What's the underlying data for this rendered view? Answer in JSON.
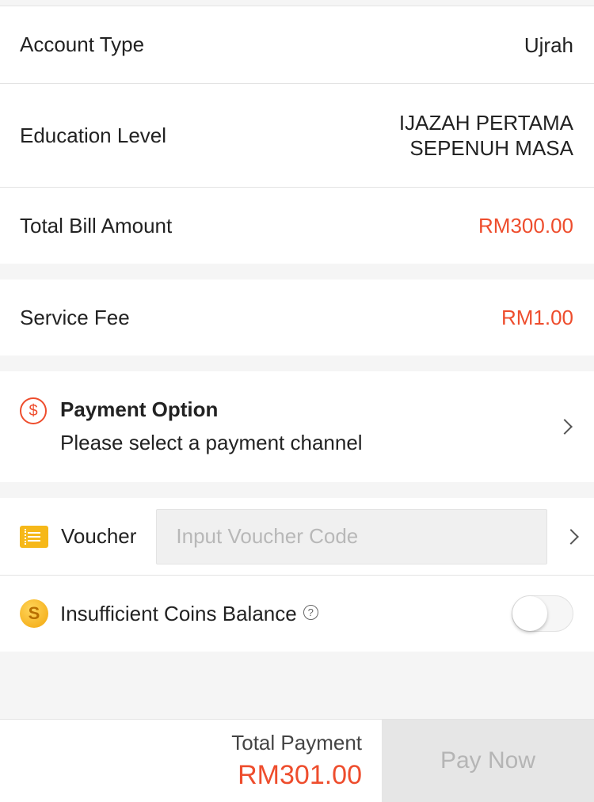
{
  "details": {
    "account_type_label": "Account Type",
    "account_type_value": "Ujrah",
    "education_level_label": "Education Level",
    "education_level_value_line1": "IJAZAH PERTAMA",
    "education_level_value_line2": "SEPENUH MASA",
    "total_bill_label": "Total Bill Amount",
    "total_bill_value": "RM300.00"
  },
  "service_fee": {
    "label": "Service Fee",
    "value": "RM1.00"
  },
  "payment_option": {
    "icon": "dollar-circle-icon",
    "title": "Payment Option",
    "subtitle": "Please select a payment channel"
  },
  "voucher": {
    "icon": "voucher-ticket-icon",
    "label": "Voucher",
    "placeholder": "Input Voucher Code"
  },
  "coins": {
    "icon": "coin-icon",
    "label": "Insufficient Coins Balance",
    "toggle_on": false
  },
  "footer": {
    "total_label": "Total Payment",
    "total_value": "RM301.00",
    "pay_button": "Pay Now"
  },
  "colors": {
    "accent": "#ee4d2d",
    "coin": "#f6b819"
  }
}
